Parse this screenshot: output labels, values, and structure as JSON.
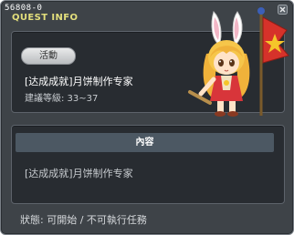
{
  "window": {
    "quest_id": "56808-0",
    "title": "QUEST INFO"
  },
  "quest": {
    "tag": "活動",
    "name": "[达成成就]月饼制作专家",
    "level_requirement": "建議等級: 33~37"
  },
  "content_section": {
    "header": "內容",
    "text": "[达成成就]月饼制作专家"
  },
  "status": {
    "text": "狀態: 可開始 / 不可執行任務"
  },
  "colors": {
    "title": "#e3df7c",
    "window_bg": "#3e4348",
    "panel_bg": "#282c31",
    "header_bar": "#4c5863"
  }
}
